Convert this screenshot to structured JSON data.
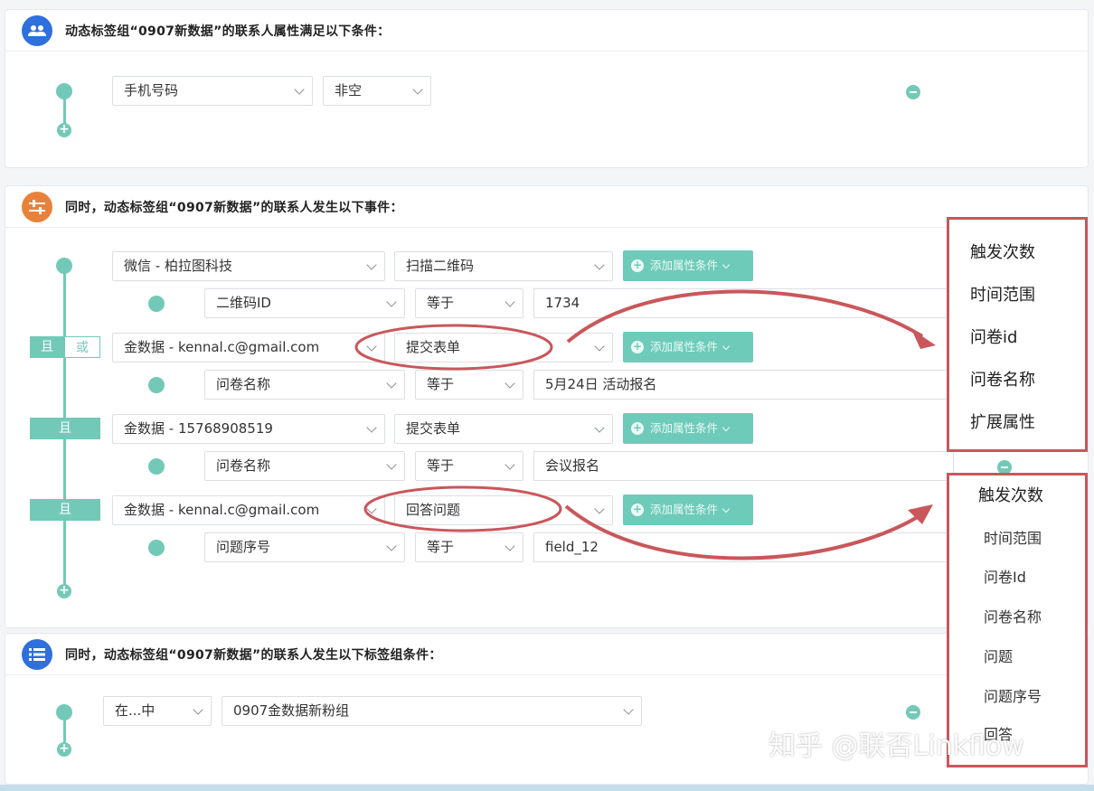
{
  "section1": {
    "title": "动态标签组“0907新数据”的联系人属性满足以下条件：",
    "attr_select": "手机号码",
    "op_select": "非空"
  },
  "section2": {
    "title": "同时，动态标签组“0907新数据”的联系人发生以下事件：",
    "add_condition_label": "添加属性条件",
    "logic_and": "且",
    "logic_or": "或",
    "events": [
      {
        "source": "微信 - 柏拉图科技",
        "event": "扫描二维码",
        "cond_attr": "二维码ID",
        "cond_op": "等于",
        "cond_value": "1734"
      },
      {
        "source": "金数据 - kennal.c@gmail.com",
        "event": "提交表单",
        "cond_attr": "问卷名称",
        "cond_op": "等于",
        "cond_value": "5月24日 活动报名"
      },
      {
        "source": "金数据 - 15768908519",
        "event": "提交表单",
        "cond_attr": "问卷名称",
        "cond_op": "等于",
        "cond_value": "会议报名"
      },
      {
        "source": "金数据 - kennal.c@gmail.com",
        "event": "回答问题",
        "cond_attr": "问题序号",
        "cond_op": "等于",
        "cond_value": "field_12"
      }
    ]
  },
  "section3": {
    "title": "同时，动态标签组“0907新数据”的联系人发生以下标签组条件：",
    "op_select": "在...中",
    "group_select": "0907金数据新粉组"
  },
  "popup_submit": [
    "触发次数",
    "时间范围",
    "问卷id",
    "问卷名称",
    "扩展属性"
  ],
  "popup_answer": [
    "触发次数",
    "时间范围",
    "问卷Id",
    "问卷名称",
    "问题",
    "问题序号",
    "回答"
  ],
  "watermark": "知乎 @联否Linkflow",
  "colors": {
    "accent": "#73c9b8",
    "highlight_red": "#c9575b",
    "blue_icon": "#2f6fde",
    "orange_icon": "#e8823a"
  }
}
